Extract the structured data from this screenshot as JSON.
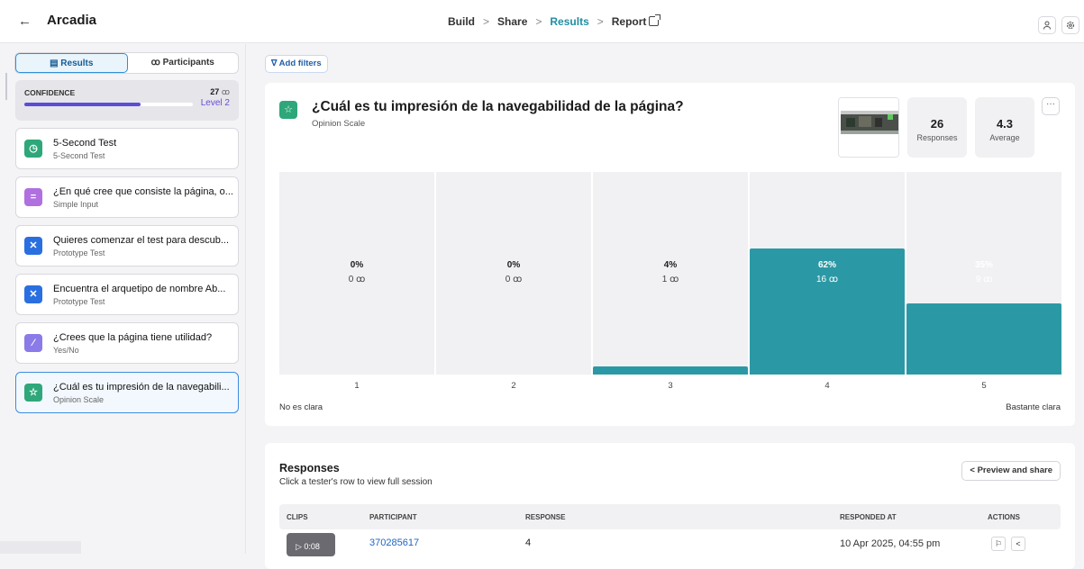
{
  "app": {
    "name": "Arcadia",
    "back_glyph": "←"
  },
  "breadcrumbs": [
    {
      "label": "Build"
    },
    {
      "label": "Share"
    },
    {
      "label": "Results",
      "active": true
    },
    {
      "label": "Report"
    }
  ],
  "breadcrumb_sep": ">",
  "sidebar": {
    "tabs": [
      {
        "label": "Results",
        "icon": "list-icon"
      },
      {
        "label": "Participants",
        "icon": "people-icon"
      }
    ],
    "confidence": {
      "label": "CONFIDENCE",
      "count": "27",
      "level": "Level 2",
      "progress": 0.69
    },
    "items": [
      {
        "title": "5-Second Test",
        "subtitle": "5-Second Test",
        "icon": "timer-icon",
        "color": "#2ea77a",
        "glyph": "◷"
      },
      {
        "title": "¿En qué cree que consiste la página, o...",
        "subtitle": "Simple Input",
        "icon": "text-input-icon",
        "color": "#b070e0",
        "glyph": "="
      },
      {
        "title": "Quieres comenzar el test para descub...",
        "subtitle": "Prototype Test",
        "icon": "prototype-icon",
        "color": "#2a6fe0",
        "glyph": "✕"
      },
      {
        "title": "Encuentra el arquetipo de nombre Ab...",
        "subtitle": "Prototype Test",
        "icon": "prototype-icon",
        "color": "#2a6fe0",
        "glyph": "✕"
      },
      {
        "title": "¿Crees que la página tiene utilidad?",
        "subtitle": "Yes/No",
        "icon": "yes-no-icon",
        "color": "#8a7be8",
        "glyph": "⁄"
      },
      {
        "title": "¿Cuál es tu impresión de la navegabili...",
        "subtitle": "Opinion Scale",
        "icon": "star-icon",
        "color": "#2ea77a",
        "glyph": "☆",
        "selected": true
      }
    ]
  },
  "filters": {
    "label": "Add filters"
  },
  "question": {
    "title": "¿Cuál es tu impresión de la navegabilidad de la página?",
    "type": "Opinion Scale",
    "stats": [
      {
        "value": "26",
        "label": "Responses"
      },
      {
        "value": "4.3",
        "label": "Average"
      }
    ],
    "more": "···"
  },
  "distribution": [
    {
      "scale": "1",
      "pct": "0%",
      "count": "0",
      "fraction": 0
    },
    {
      "scale": "2",
      "pct": "0%",
      "count": "0",
      "fraction": 0
    },
    {
      "scale": "3",
      "pct": "4%",
      "count": "1",
      "fraction": 0.04
    },
    {
      "scale": "4",
      "pct": "62%",
      "count": "16",
      "fraction": 0.62
    },
    {
      "scale": "5",
      "pct": "35%",
      "count": "9",
      "fraction": 0.35
    }
  ],
  "scale_labels": {
    "low": "No es clara",
    "high": "Bastante clara"
  },
  "responses": {
    "title": "Responses",
    "subtitle": "Click a tester's row to view full session",
    "share_label": "Preview and share",
    "columns": [
      "CLIPS",
      "PARTICIPANT",
      "RESPONSE",
      "RESPONDED AT",
      "ACTIONS"
    ],
    "rows": [
      {
        "clip": "▷ 0:08",
        "participant": "370285617",
        "response": "4",
        "responded_at": "10 Apr 2025, 04:55 pm"
      }
    ]
  },
  "colors": {
    "accent": "#1f8fa3",
    "bar": "#2b99a5",
    "bar_empty": "#f1f1f4"
  }
}
